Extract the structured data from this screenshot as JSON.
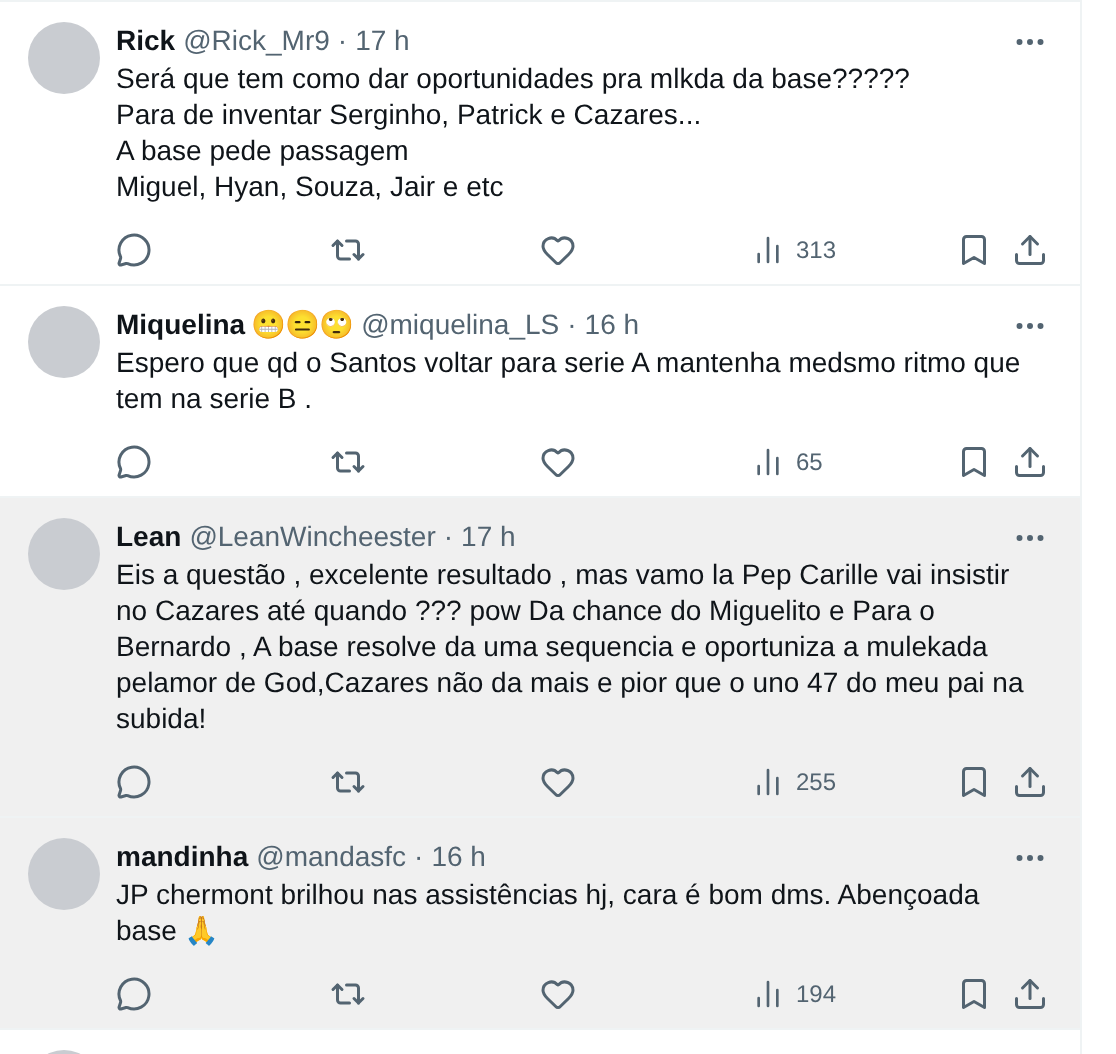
{
  "tweets": [
    {
      "name": "Rick",
      "handle": "@Rick_Mr9",
      "separator": "·",
      "time": "17 h",
      "text": "Será que tem como dar oportunidades pra mlkda da base?????\nPara de inventar Serginho, Patrick e Cazares...\nA base pede passagem\nMiguel, Hyan, Souza, Jair e etc",
      "views": "313",
      "highlighted": false
    },
    {
      "name": "Miquelina",
      "emoji": "😬😑🙄",
      "handle": "@miquelina_LS",
      "separator": "·",
      "time": "16 h",
      "text": "Espero que qd o Santos voltar para serie A mantenha medsmo ritmo que tem na serie B .",
      "views": "65",
      "highlighted": false
    },
    {
      "name": "Lean",
      "handle": "@LeanWincheester",
      "separator": "·",
      "time": "17 h",
      "text": "Eis a questão , excelente resultado , mas vamo la Pep Carille vai insistir no Cazares até quando ??? pow Da chance do Miguelito e Para o Bernardo , A base resolve da uma sequencia e oportuniza a mulekada pelamor de God,Cazares não da mais e pior que o uno 47 do meu pai na subida!",
      "views": "255",
      "highlighted": true
    },
    {
      "name": "mandinha",
      "handle": "@mandasfc",
      "separator": "·",
      "time": "16 h",
      "text": "JP chermont brilhou nas assistências hj, cara é bom dms. Abençoada base 🙏",
      "views": "194",
      "highlighted": true
    }
  ]
}
